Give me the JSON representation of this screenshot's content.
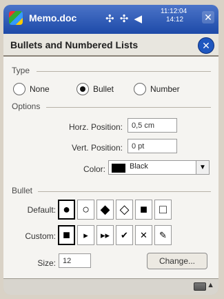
{
  "window": {
    "app_title": "Memo.doc",
    "status_icons": "✣ ✣ ◀",
    "clock_top": "11:12:04",
    "clock_bottom": "14:12"
  },
  "dialog": {
    "title": "Bullets and Numbered Lists"
  },
  "type_section": {
    "label": "Type",
    "options": [
      {
        "label": "None",
        "selected": false
      },
      {
        "label": "Bullet",
        "selected": true
      },
      {
        "label": "Number",
        "selected": false
      }
    ]
  },
  "options_section": {
    "label": "Options",
    "horz_label": "Horz. Position:",
    "horz_value": "0,5 cm",
    "vert_label": "Vert. Position:",
    "vert_value": "0 pt",
    "color_label": "Color:",
    "color_value": "Black",
    "color_swatch": "#000000"
  },
  "bullet_section": {
    "label": "Bullet",
    "default_label": "Default:",
    "custom_label": "Custom:",
    "size_label": "Size:",
    "size_value": "12",
    "change_label": "Change...",
    "default_bullets": [
      "●",
      "○",
      "◆",
      "◇",
      "■",
      "□"
    ],
    "custom_bullets": [
      "■",
      "▸",
      "▸▸",
      "✔",
      "✕",
      "✎"
    ]
  }
}
